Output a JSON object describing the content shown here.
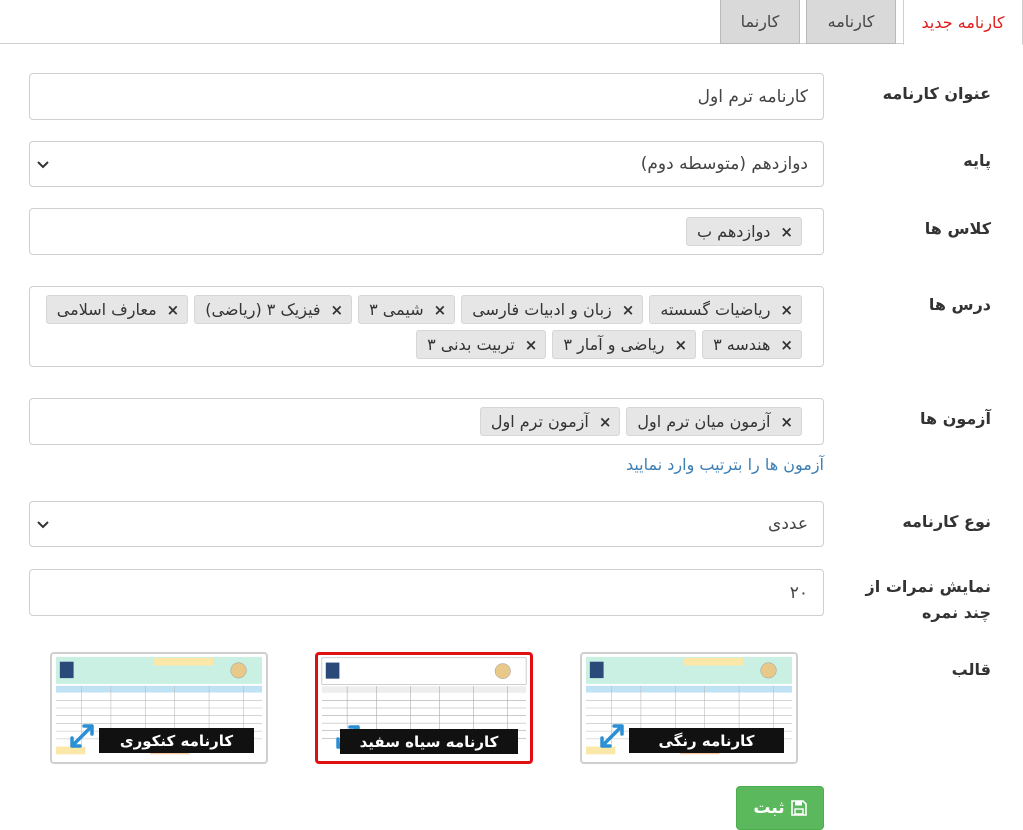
{
  "tabs": [
    {
      "label": "کارنامه جدید",
      "active": true
    },
    {
      "label": "کارنامه",
      "active": false
    },
    {
      "label": "کارنما",
      "active": false
    }
  ],
  "form": {
    "title": {
      "label": "عنوان کارنامه",
      "value": "کارنامه ترم اول"
    },
    "grade": {
      "label": "پایه",
      "value": "دوازدهم (متوسطه دوم)"
    },
    "classes": {
      "label": "کلاس ها",
      "chips": [
        "دوازدهم ب"
      ]
    },
    "lessons": {
      "label": "درس ها",
      "chips": [
        "ریاضیات گسسته",
        "زبان و ادبیات فارسی",
        "شیمی ۳",
        "فیزیک ۳ (ریاضی)",
        "معارف اسلامی",
        "هندسه ۳",
        "ریاضی و آمار ۳",
        "تربیت بدنی ۳"
      ]
    },
    "exams": {
      "label": "آزمون ها",
      "chips": [
        "آزمون میان ترم اول",
        "آزمون ترم اول"
      ],
      "help": "آزمون ها را بترتیب وارد نمایید"
    },
    "report_type": {
      "label": "نوع کارنامه",
      "value": "عددی"
    },
    "max_score": {
      "label_line1": "نمایش نمرات از",
      "label_line2": "چند نمره",
      "value": "۲۰"
    },
    "template": {
      "label": "قالب",
      "options": [
        {
          "name": "کارنامه رنگی",
          "selected": false
        },
        {
          "name": "کارنامه سیاه سفید",
          "selected": true
        },
        {
          "name": "کارنامه کنکوری",
          "selected": false
        }
      ]
    },
    "submit_label": "ثبت"
  },
  "icons": {
    "chevron": "chevron-down-icon",
    "remove": "close-icon",
    "expand": "expand-arrows-icon",
    "save": "floppy-disk-icon"
  },
  "colors": {
    "active_tab": "#e21b1b",
    "link": "#3d7fb5",
    "selected_border": "#e10f12",
    "submit": "#5cb85c"
  }
}
